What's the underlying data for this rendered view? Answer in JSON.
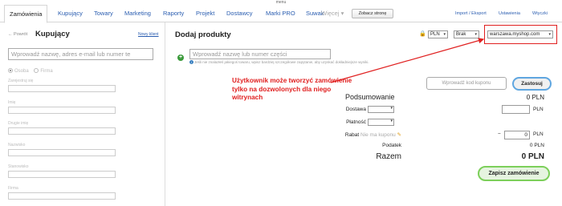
{
  "menu_label": "menu",
  "nav": {
    "tabs": [
      {
        "label": "Zamówienia",
        "active": true
      },
      {
        "label": "Kupujący"
      },
      {
        "label": "Towary"
      },
      {
        "label": "Marketing"
      },
      {
        "label": "Raporty"
      },
      {
        "label": "Projekt"
      },
      {
        "label": "Dostawcy"
      },
      {
        "label": "Marki PRO"
      },
      {
        "label": "Suwak"
      },
      {
        "label": "Więcej ▾"
      }
    ],
    "zobacz_label": "Zobacz stronę",
    "right_links": [
      "Import / Eksport",
      "Ustawienia",
      "Wtyczki"
    ]
  },
  "buyer": {
    "back_label": "← Powrót",
    "title": "Kupujący",
    "new_client": "Nowy klient",
    "search_placeholder": "Wprowadź nazwę, adres e-mail lub numer te",
    "radio_person": "Osoba",
    "radio_company": "Firma",
    "fields": [
      "Zarejestruj się",
      "Imię",
      "Drugie imię",
      "Nazwisko",
      "Stanowisko",
      "Firma"
    ]
  },
  "products": {
    "title": "Dodaj produkty",
    "currency": "PLN",
    "vat": "Brak",
    "shop": "warszawa.myshop.com",
    "search_placeholder": "Wprowadź nazwę lub numer części",
    "info": "Jeśli nie znalazłeś jakiegoś towaru, wpisz bardziej szczegółowe zapytanie, aby uzyskać dokładniejsze wyniki."
  },
  "annotation": "Użytkownik może tworzyć zamówienie tylko na dozwolonych dla niego witrynach",
  "summary": {
    "coupon_placeholder": "Wprowadź kod kuponu",
    "apply_label": "Zastosuj",
    "title": "Podsumowanie",
    "title_value": "0 PLN",
    "delivery_label": "Dostawa",
    "delivery_unit": "PLN",
    "payment_label": "Płatność",
    "discount_label": "Rabat",
    "discount_note": "Nie ma kuponu",
    "discount_minus": "−",
    "discount_value": "0",
    "discount_unit": "PLN",
    "tax_label": "Podatek",
    "tax_value": "0 PLN",
    "total_label": "Razem",
    "total_value": "0 PLN",
    "save_label": "Zapisz zamówienie"
  },
  "colors": {
    "accent": "#2a5db0",
    "annotation": "#e02020",
    "save_border": "#7ccf5a",
    "apply_border": "#5fa6e0"
  }
}
